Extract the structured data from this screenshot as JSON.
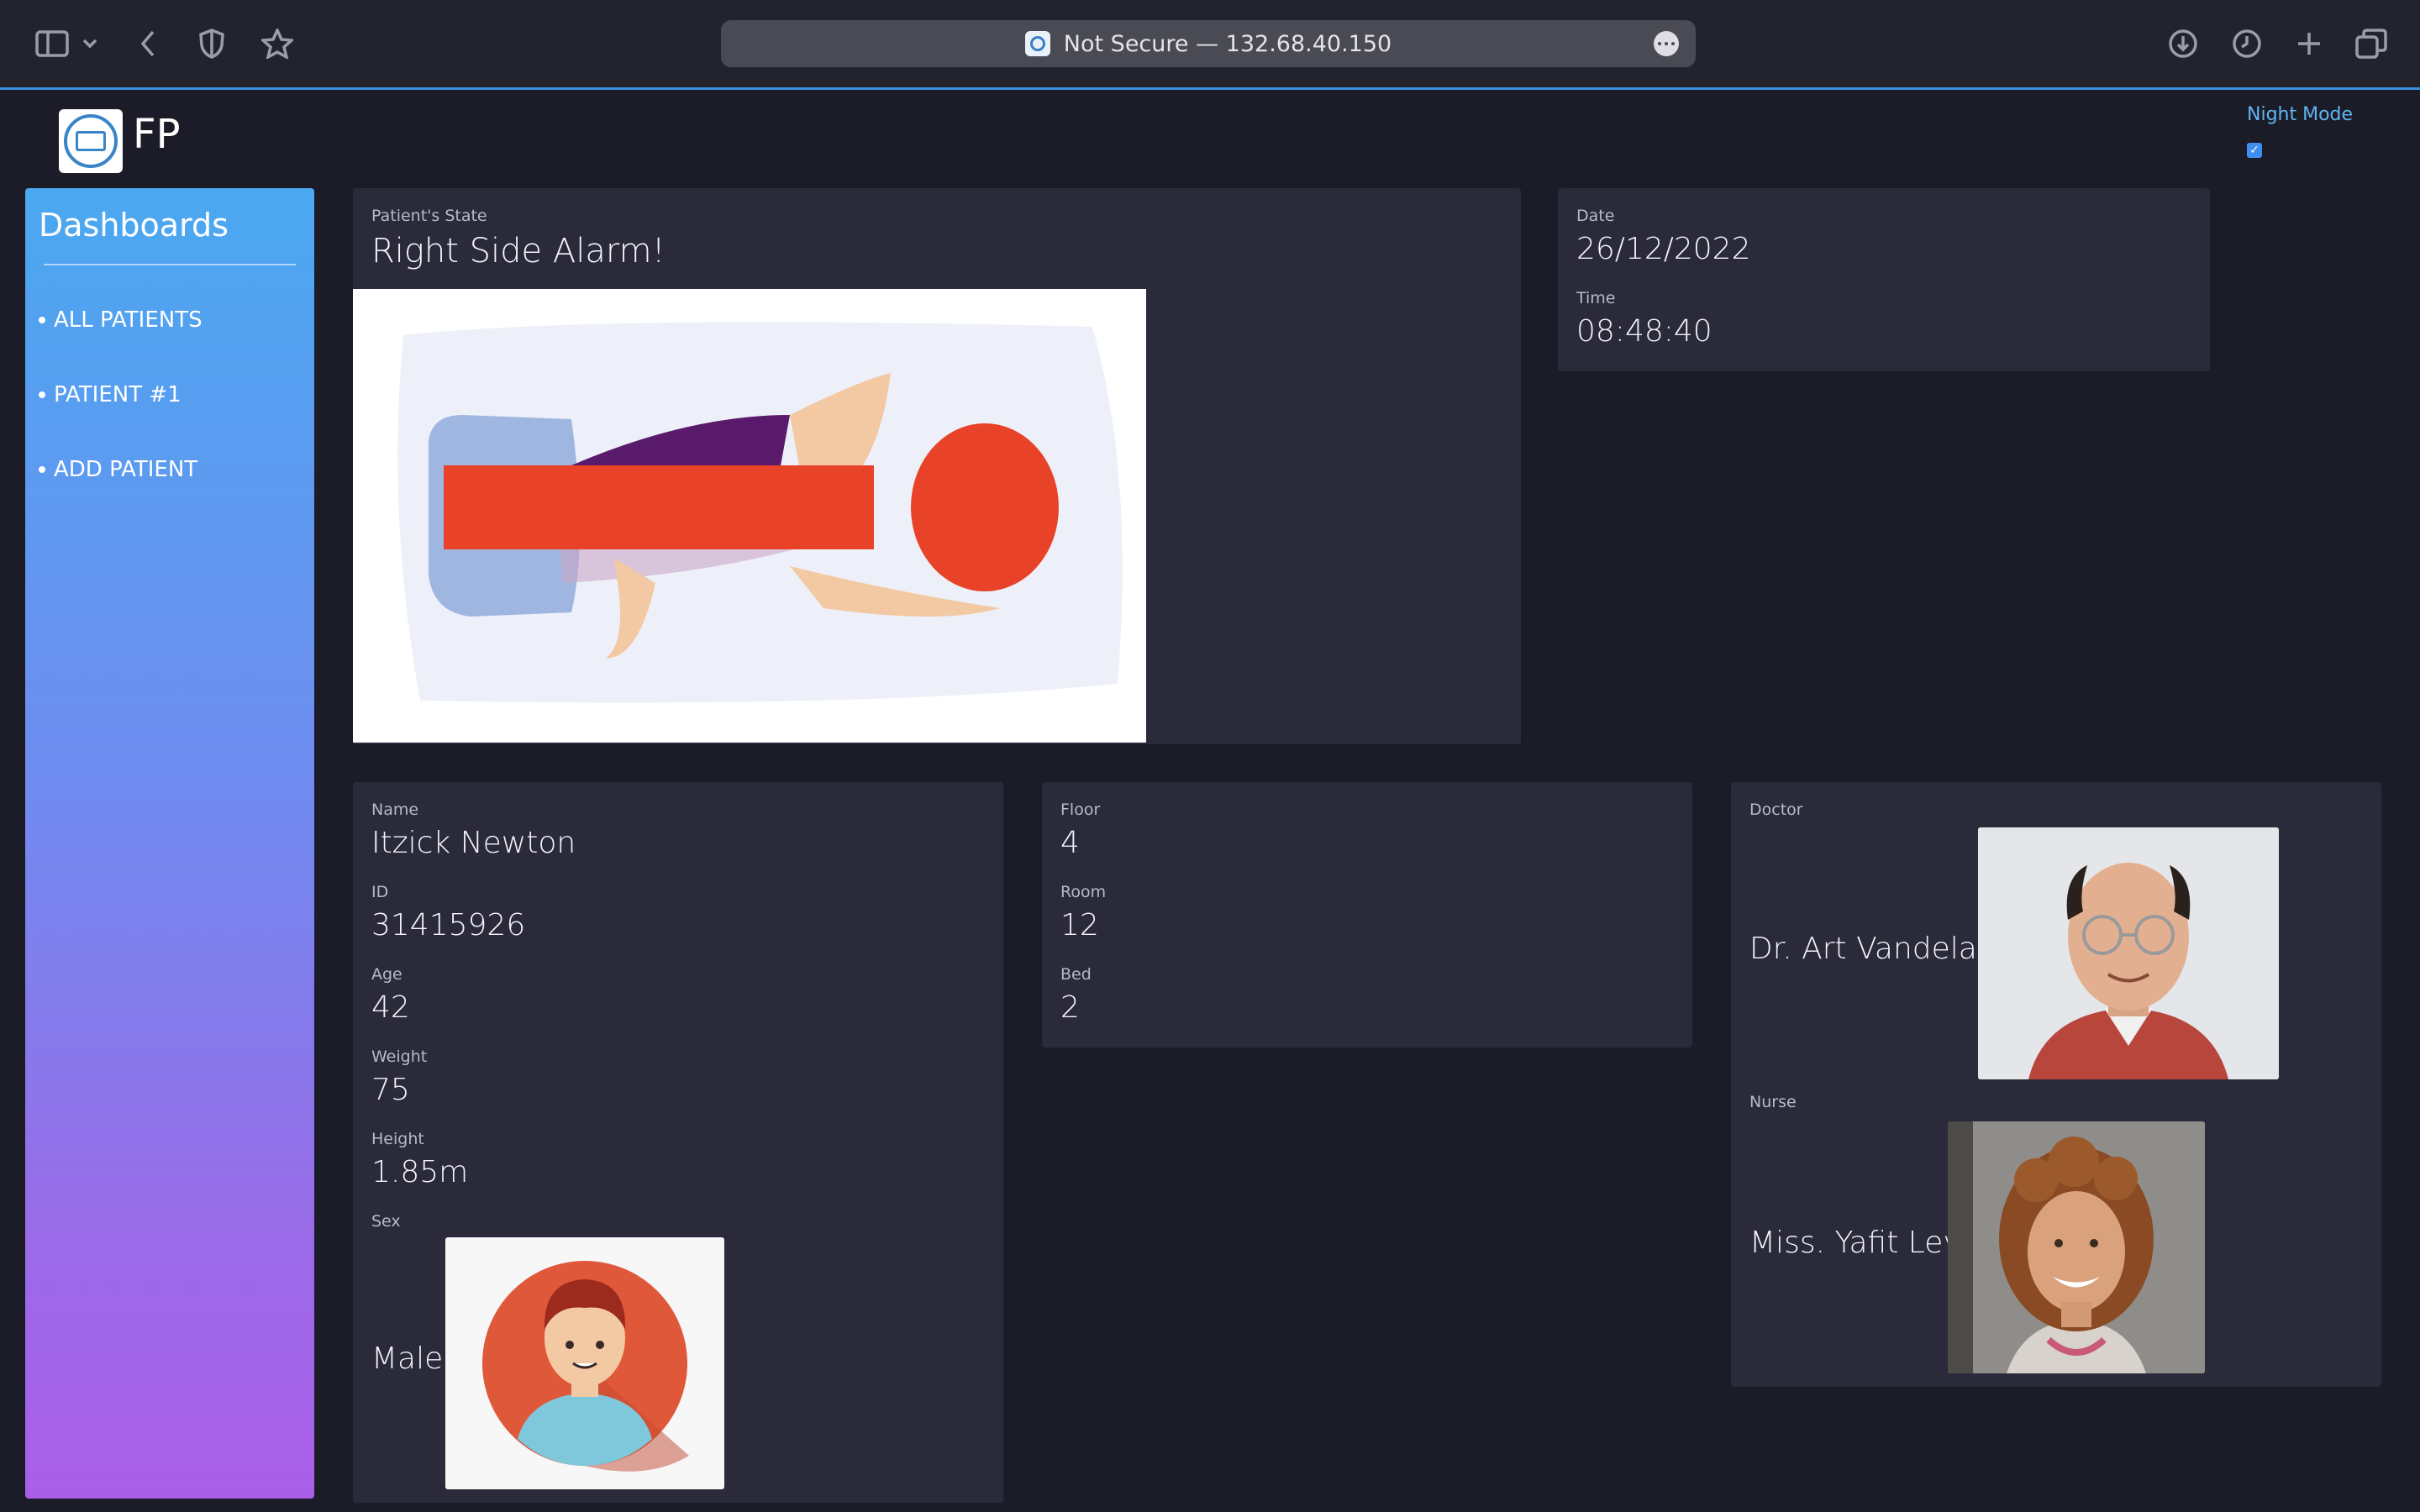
{
  "browser": {
    "url_text": "Not Secure — 132.68.40.150"
  },
  "header": {
    "brand": "FP",
    "night_mode_label": "Night Mode",
    "night_mode_checked": true
  },
  "sidebar": {
    "title": "Dashboards",
    "items": [
      {
        "label": "ALL PATIENTS"
      },
      {
        "label": "PATIENT #1"
      },
      {
        "label": "ADD PATIENT"
      }
    ]
  },
  "state_card": {
    "label": "Patient's State",
    "value": "Right Side Alarm!"
  },
  "datetime_card": {
    "date_label": "Date",
    "date_value": "26/12/2022",
    "time_label": "Time",
    "time_value": "08:48:40"
  },
  "patient_card": {
    "name_label": "Name",
    "name_value": "Itzick Newton",
    "id_label": "ID",
    "id_value": "31415926",
    "age_label": "Age",
    "age_value": "42",
    "weight_label": "Weight",
    "weight_value": "75",
    "height_label": "Height",
    "height_value": "1.85m",
    "sex_label": "Sex",
    "sex_value": "Male"
  },
  "location_card": {
    "floor_label": "Floor",
    "floor_value": "4",
    "room_label": "Room",
    "room_value": "12",
    "bed_label": "Bed",
    "bed_value": "2"
  },
  "staff_card": {
    "doctor_label": "Doctor",
    "doctor_name": "Dr. Art Vandelay",
    "nurse_label": "Nurse",
    "nurse_name": "Miss. Yafit Levi"
  },
  "colors": {
    "background": "#1c1c28",
    "card": "#2a2a3a",
    "alarm_red": "#e84228",
    "accent_blue": "#5fb6f0"
  }
}
